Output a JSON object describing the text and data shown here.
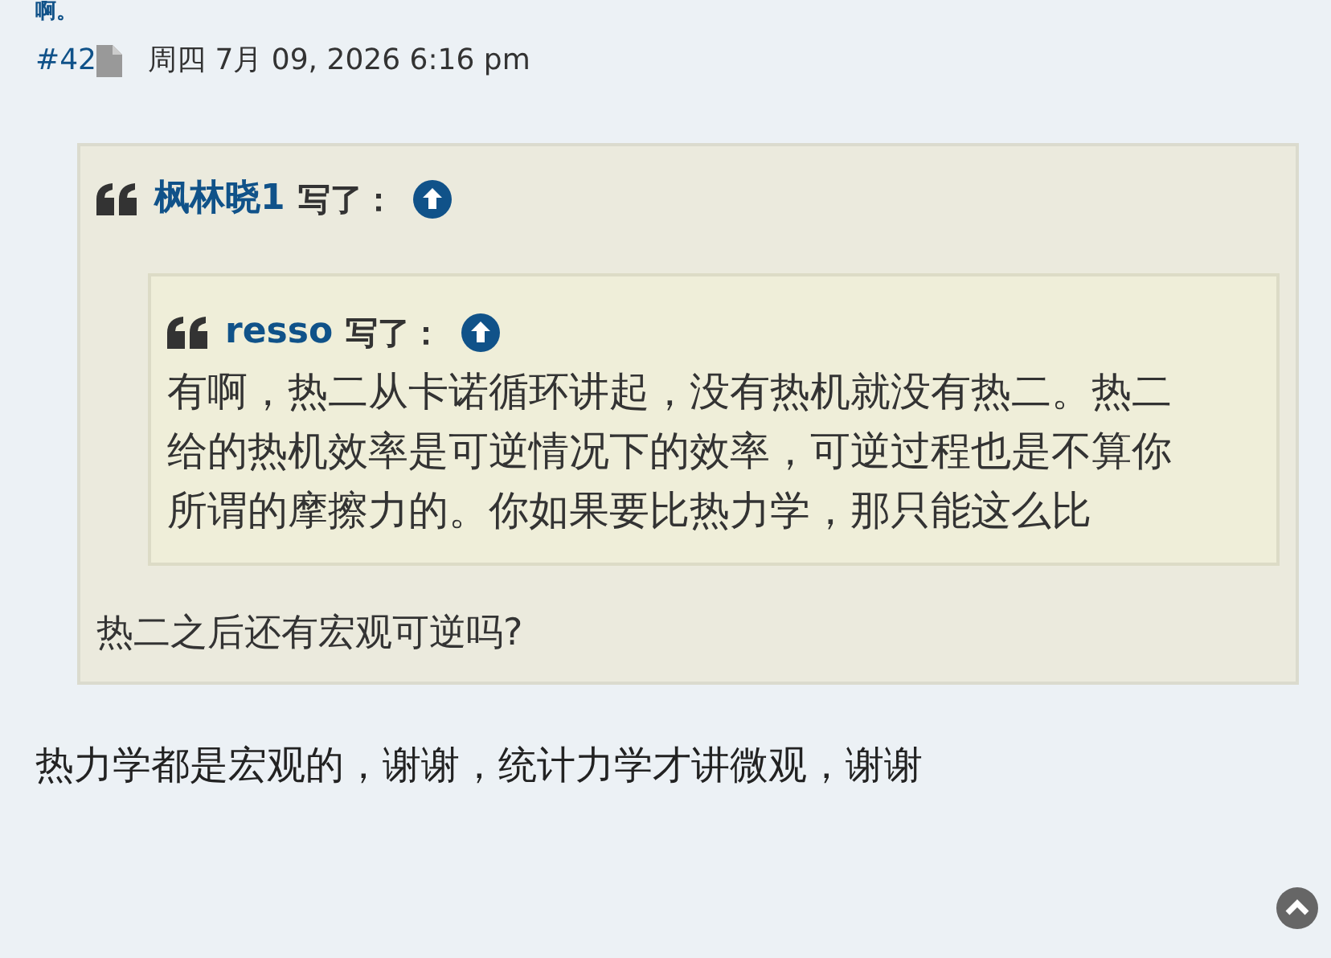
{
  "previous_post_tail": "啊。",
  "post": {
    "number": "#42",
    "date": "周四 7月 09, 2026 6:16 pm",
    "quote": {
      "author": "枫林晓1",
      "wrote": "写了：",
      "quote": {
        "author": "resso",
        "wrote": "写了：",
        "body": "有啊，热二从卡诺循环讲起，没有热机就没有热二。热二给的热机效率是可逆情况下的效率，可逆过程也是不算你所谓的摩擦力的。你如果要比热力学，那只能这么比"
      },
      "body": "热二之后还有宏观可逆吗?"
    },
    "body": "热力学都是宏观的，谢谢，统计力学才讲微观，谢谢"
  }
}
